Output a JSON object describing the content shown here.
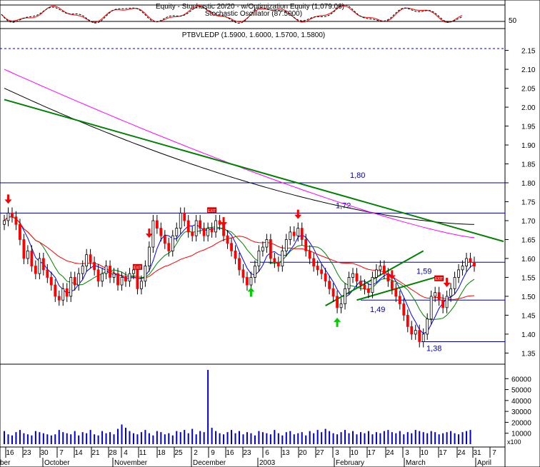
{
  "window": {
    "title_line1": "Equity - Stochastic 20/20 - w/Optimization Equity (1,079.06)",
    "title_line2": "Stochastic Oscillator (87.5000)",
    "price_title": "PTBVLEDP (1.5900, 1.6000, 1.5700, 1.5800)"
  },
  "colors": {
    "background": "#ffffff",
    "up_candle": "#ffffff",
    "down_candle": "#ff0000",
    "level_line": "#0000aa",
    "trend_green": "#008000",
    "ma_black": "#000000",
    "ma_magenta": "#ff00ff",
    "ma_red": "#ff0000",
    "ma_green": "#008000",
    "ma_blue": "#0000ff",
    "arrow_down": "#ff0000",
    "arrow_up": "#00cc00",
    "volume": "#0000cc"
  },
  "chart_data": {
    "type": "candlestick",
    "symbol": "PTBVLEDP",
    "last_ohlc": {
      "open": 1.59,
      "high": 1.6,
      "low": 1.57,
      "close": 1.58
    },
    "price_ylim": [
      1.33,
      2.17
    ],
    "price_ticks": [
      "2.15",
      "2.10",
      "2.05",
      "2.00",
      "1.95",
      "1.90",
      "1.85",
      "1.80",
      "1.75",
      "1.70",
      "1.65",
      "1.60",
      "1.55",
      "1.50",
      "1.45",
      "1.40",
      "1.35"
    ],
    "volume_ylim": [
      0,
      70000
    ],
    "volume_ticks": [
      "60000",
      "50000",
      "40000",
      "30000",
      "20000",
      "10000"
    ],
    "volume_unit_label": "x100",
    "stoch_tick": "50",
    "stoch_value": 87.5,
    "x_day_labels": [
      "16",
      "23",
      "30",
      "7",
      "14",
      "21",
      "28",
      "4",
      "11",
      "18",
      "25",
      "2",
      "9",
      "16",
      "23",
      "6",
      "13",
      "20",
      "27",
      "3",
      "10",
      "17",
      "24",
      "3",
      "10",
      "17",
      "24",
      "31",
      "7"
    ],
    "x_month_labels": [
      "ber",
      "October",
      "November",
      "December",
      "2003",
      "February",
      "March",
      "April"
    ],
    "horizontal_levels": [
      {
        "label": "1,80",
        "value": 1.8
      },
      {
        "label": "1,72",
        "value": 1.72
      },
      {
        "label": "1,59",
        "value": 1.59
      },
      {
        "label": "1,49",
        "value": 1.49
      },
      {
        "label": "1,38",
        "value": 1.38
      }
    ],
    "trend_lines": [
      {
        "name": "",
        "color": "#008000",
        "from": {
          "bar": 0,
          "price": 2.02
        },
        "to": {
          "bar": 135,
          "price": 1.645
        }
      },
      {
        "name": "",
        "color": "#008000",
        "from": {
          "bar": 82,
          "price": 1.475
        },
        "to": {
          "bar": 107,
          "price": 1.62
        }
      },
      {
        "name": "",
        "color": "#008000",
        "from": {
          "bar": 90,
          "price": 1.49
        },
        "to": {
          "bar": 110,
          "price": 1.55
        }
      }
    ],
    "signal_labels": [
      "EXIT",
      "EXIT",
      "EXIT"
    ],
    "volume": [
      12000,
      9000,
      8000,
      11000,
      13000,
      10000,
      9000,
      8000,
      12000,
      11000,
      10000,
      9000,
      8000,
      9000,
      13000,
      11000,
      10000,
      9000,
      12000,
      8000,
      11000,
      10000,
      13000,
      9000,
      8000,
      12000,
      10000,
      11000,
      9000,
      14000,
      18000,
      15000,
      12000,
      10000,
      9000,
      11000,
      13000,
      10000,
      8000,
      12000,
      11000,
      9000,
      10000,
      8000,
      12000,
      11000,
      13000,
      10000,
      14000,
      9000,
      12000,
      11000,
      68000,
      15000,
      12000,
      10000,
      9000,
      11000,
      13000,
      10000,
      12000,
      9000,
      11000,
      10000,
      8000,
      12000,
      11000,
      10000,
      9000,
      13000,
      10000,
      8000,
      11000,
      12000,
      9000,
      10000,
      11000,
      8000,
      12000,
      10000,
      13000,
      11000,
      14000,
      12000,
      10000,
      9000,
      11000,
      13000,
      10000,
      12000,
      9000,
      11000,
      10000,
      12000,
      9000,
      11000,
      10000,
      12000,
      13000,
      11000,
      10000,
      12000,
      9000,
      11000,
      10000,
      13000,
      12000,
      11000,
      10000,
      12000,
      11000,
      9000,
      10000,
      11000,
      12000,
      10000,
      9000,
      11000,
      12000,
      13000
    ],
    "closes": [
      1.7,
      1.72,
      1.71,
      1.69,
      1.65,
      1.6,
      1.62,
      1.58,
      1.56,
      1.6,
      1.57,
      1.55,
      1.53,
      1.5,
      1.49,
      1.52,
      1.5,
      1.55,
      1.53,
      1.56,
      1.58,
      1.61,
      1.59,
      1.57,
      1.54,
      1.56,
      1.58,
      1.55,
      1.56,
      1.53,
      1.55,
      1.54,
      1.56,
      1.57,
      1.52,
      1.54,
      1.58,
      1.63,
      1.7,
      1.68,
      1.66,
      1.64,
      1.62,
      1.66,
      1.68,
      1.72,
      1.7,
      1.67,
      1.66,
      1.7,
      1.68,
      1.66,
      1.68,
      1.67,
      1.7,
      1.69,
      1.66,
      1.64,
      1.62,
      1.6,
      1.57,
      1.55,
      1.53,
      1.55,
      1.58,
      1.62,
      1.63,
      1.65,
      1.6,
      1.59,
      1.58,
      1.62,
      1.65,
      1.67,
      1.66,
      1.68,
      1.65,
      1.62,
      1.6,
      1.58,
      1.57,
      1.56,
      1.54,
      1.52,
      1.5,
      1.47,
      1.48,
      1.52,
      1.55,
      1.56,
      1.54,
      1.53,
      1.52,
      1.51,
      1.55,
      1.57,
      1.58,
      1.56,
      1.54,
      1.52,
      1.5,
      1.48,
      1.45,
      1.42,
      1.4,
      1.41,
      1.38,
      1.4,
      1.44,
      1.5,
      1.51,
      1.49,
      1.47,
      1.5,
      1.52,
      1.55,
      1.57,
      1.58,
      1.6,
      1.59,
      1.58
    ],
    "overlay_series": [
      {
        "color": "#000000",
        "values": [
          2.05,
          1.69
        ]
      },
      {
        "color": "#ff00ff",
        "values": [
          2.1,
          1.655
        ]
      }
    ],
    "arrows": [
      {
        "dir": "down",
        "bar": 1
      },
      {
        "dir": "down",
        "bar": 37
      },
      {
        "dir": "down",
        "bar": 56
      },
      {
        "dir": "up",
        "bar": 63
      },
      {
        "dir": "down",
        "bar": 75
      },
      {
        "dir": "up",
        "bar": 85
      },
      {
        "dir": "down",
        "bar": 99
      },
      {
        "dir": "down",
        "bar": 113
      }
    ],
    "exit_bars": [
      34,
      53,
      111
    ]
  }
}
